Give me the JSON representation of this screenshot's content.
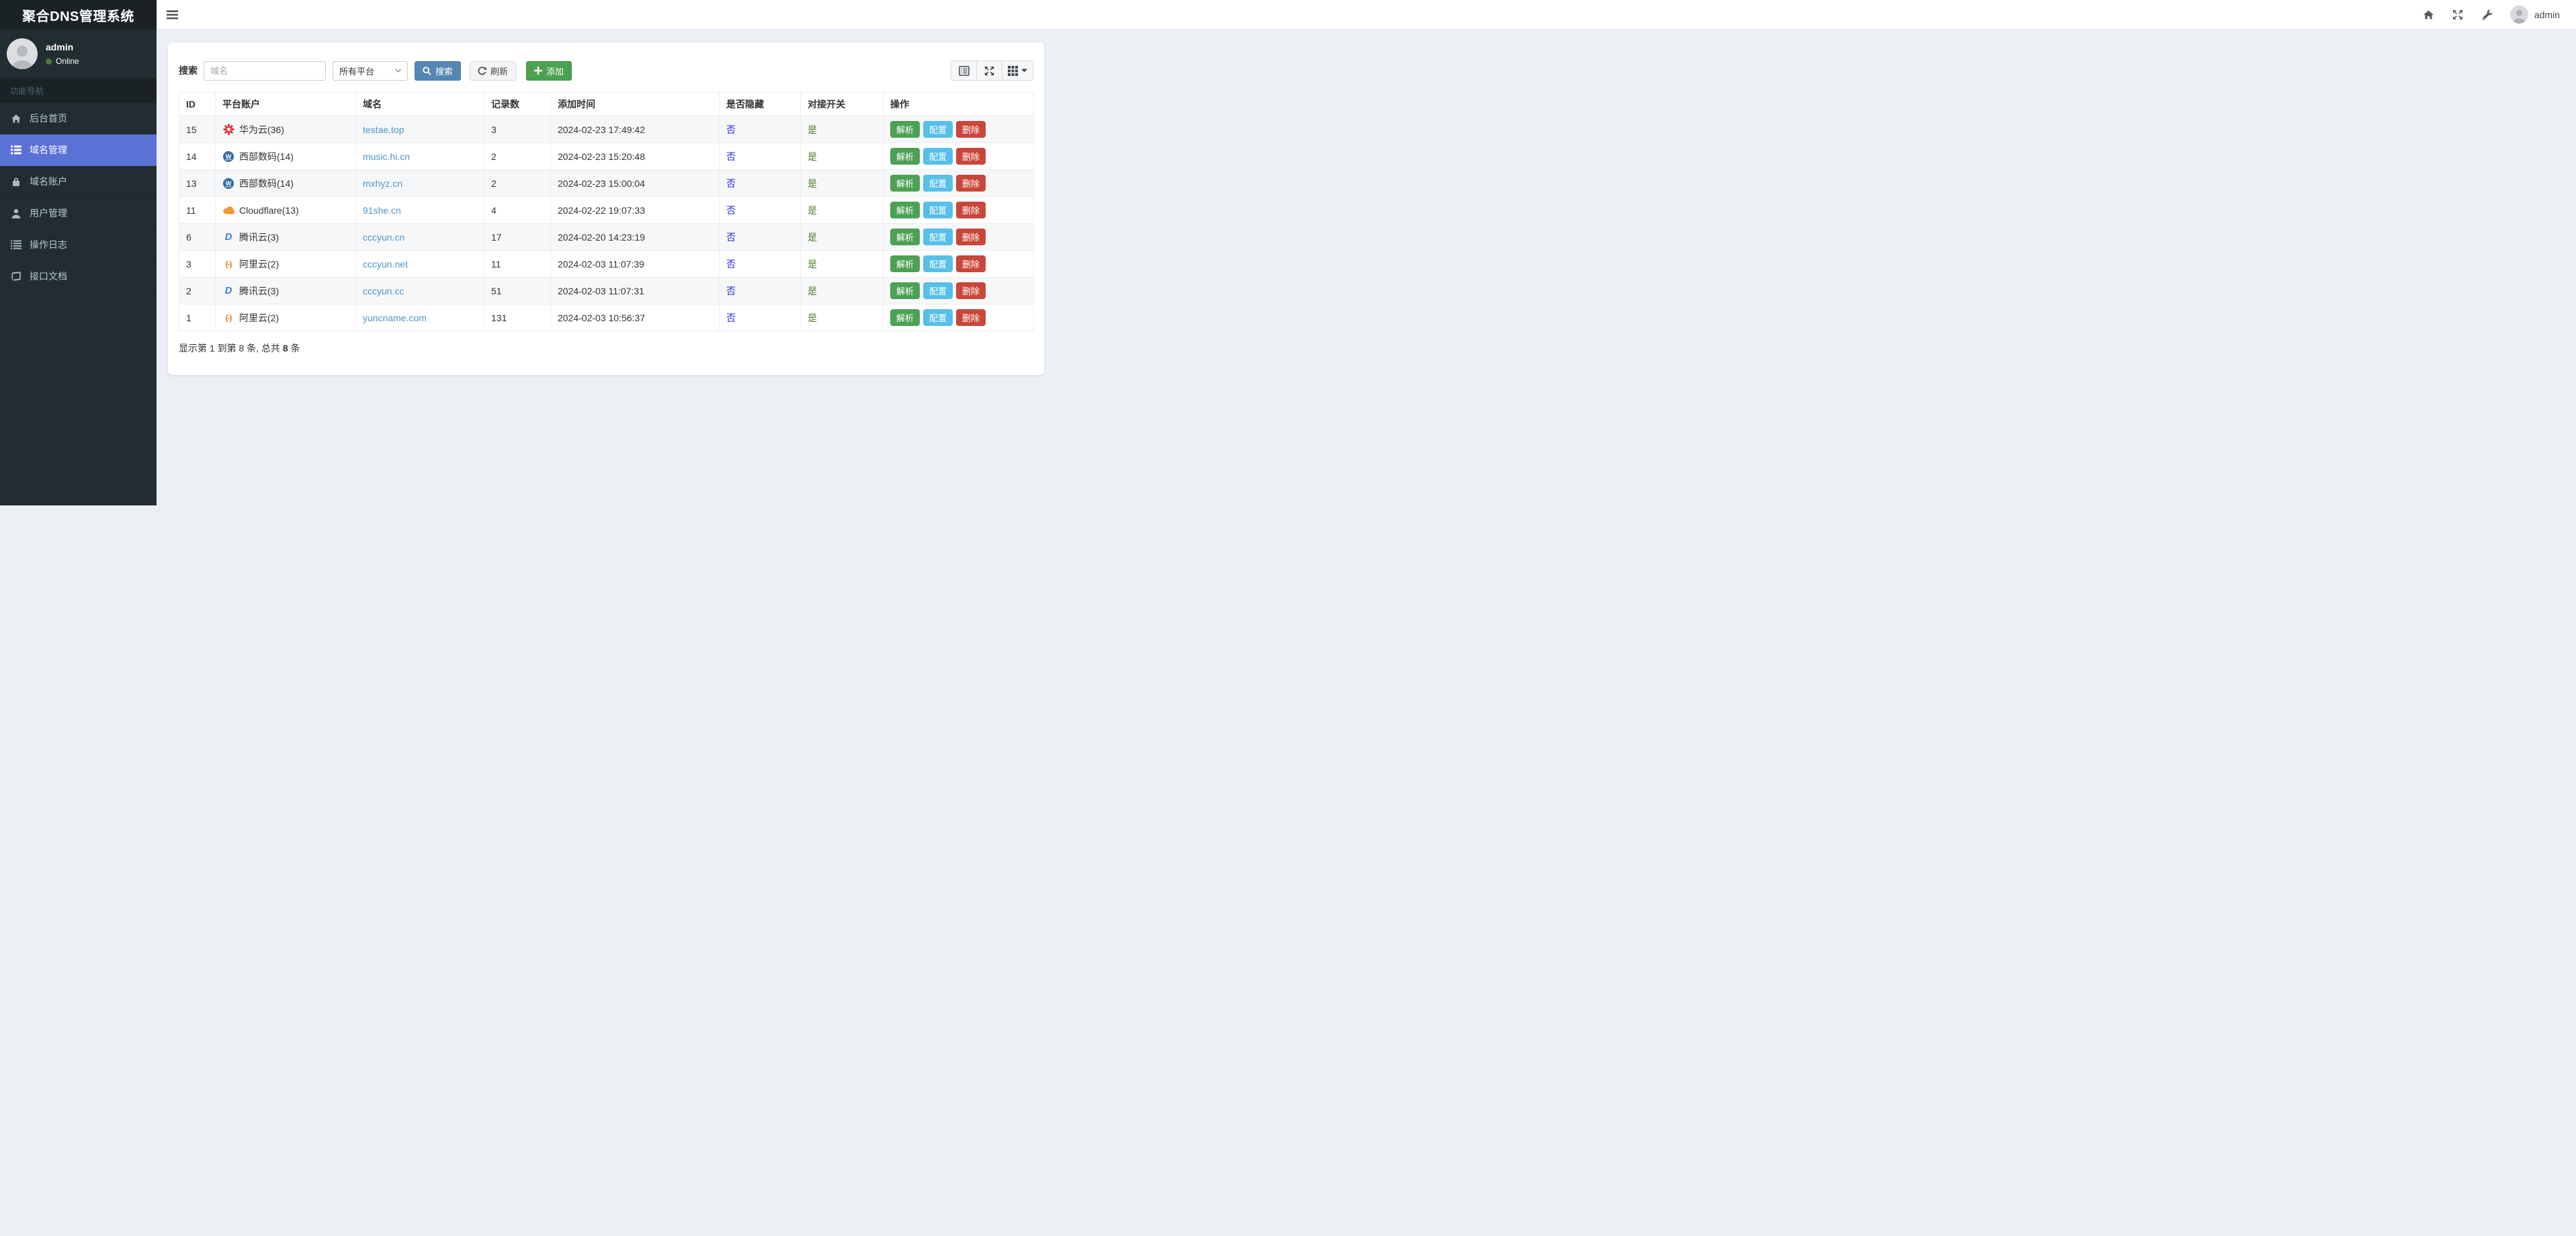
{
  "app": {
    "title": "聚合DNS管理系统"
  },
  "topbar": {
    "icons": [
      "hamburger-icon",
      "home-icon",
      "expand-icon",
      "wrench-icon"
    ],
    "username": "admin"
  },
  "sidebar": {
    "user": {
      "name": "admin",
      "status": "Online"
    },
    "nav_header": "功能导航",
    "items": [
      {
        "label": "后台首页",
        "icon": "home-icon",
        "active": false
      },
      {
        "label": "域名管理",
        "icon": "th-list-icon",
        "active": true
      },
      {
        "label": "域名账户",
        "icon": "lock-icon",
        "active": false
      },
      {
        "label": "用户管理",
        "icon": "user-icon",
        "active": false
      },
      {
        "label": "操作日志",
        "icon": "list-icon",
        "active": false
      },
      {
        "label": "接口文档",
        "icon": "book-icon",
        "active": false
      }
    ]
  },
  "toolbar": {
    "search_label": "搜索",
    "search_placeholder": "域名",
    "platform_select_value": "所有平台",
    "search_button": "搜索",
    "refresh_button": "刷新",
    "add_button": "添加",
    "view_buttons": [
      "list-alt-icon",
      "arrows-alt-icon",
      "th-grid-icon"
    ]
  },
  "table": {
    "columns": [
      "ID",
      "平台账户",
      "域名",
      "记录数",
      "添加时间",
      "是否隐藏",
      "对接开关",
      "操作"
    ],
    "actions": {
      "resolve": "解析",
      "config": "配置",
      "delete": "删除"
    },
    "rows": [
      {
        "id": "15",
        "icon": "huawei-icon",
        "platform": "华为云(36)",
        "domain": "testae.top",
        "records": "3",
        "added": "2024-02-23 17:49:42",
        "hidden": "否",
        "switch": "是"
      },
      {
        "id": "14",
        "icon": "west-icon",
        "platform": "西部数码(14)",
        "domain": "music.hi.cn",
        "records": "2",
        "added": "2024-02-23 15:20:48",
        "hidden": "否",
        "switch": "是"
      },
      {
        "id": "13",
        "icon": "west-icon",
        "platform": "西部数码(14)",
        "domain": "mxhyz.cn",
        "records": "2",
        "added": "2024-02-23 15:00:04",
        "hidden": "否",
        "switch": "是"
      },
      {
        "id": "11",
        "icon": "cloudflare-icon",
        "platform": "Cloudflare(13)",
        "domain": "91she.cn",
        "records": "4",
        "added": "2024-02-22 19:07:33",
        "hidden": "否",
        "switch": "是"
      },
      {
        "id": "6",
        "icon": "dnspod-icon",
        "platform": "腾讯云(3)",
        "domain": "cccyun.cn",
        "records": "17",
        "added": "2024-02-20 14:23:19",
        "hidden": "否",
        "switch": "是"
      },
      {
        "id": "3",
        "icon": "aliyun-icon",
        "platform": "阿里云(2)",
        "domain": "cccyun.net",
        "records": "11",
        "added": "2024-02-03 11:07:39",
        "hidden": "否",
        "switch": "是"
      },
      {
        "id": "2",
        "icon": "dnspod-icon",
        "platform": "腾讯云(3)",
        "domain": "cccyun.cc",
        "records": "51",
        "added": "2024-02-03 11:07:31",
        "hidden": "否",
        "switch": "是"
      },
      {
        "id": "1",
        "icon": "aliyun-icon",
        "platform": "阿里云(2)",
        "domain": "yuncname.com",
        "records": "131",
        "added": "2024-02-03 10:56:37",
        "hidden": "否",
        "switch": "是"
      }
    ]
  },
  "footer": {
    "prefix": "显示第 1 到第 8 条, 总共 ",
    "total": "8",
    "suffix": " 条"
  },
  "colors": {
    "sidebar_bg": "#222d32",
    "sidebar_header_bg": "#1a2226",
    "nav_active": "#5a71d6",
    "content_bg": "#ecf0f5",
    "status_online": "#4d7a42",
    "btn_search": "#5586b5",
    "btn_add": "#4ca14f",
    "btn_resolve": "#4da155",
    "btn_config": "#58bfe8",
    "btn_delete": "#c9473a",
    "domain_link": "#4e95c9",
    "hidden_link": "#2929e0",
    "switch_link": "#4e7d28"
  }
}
